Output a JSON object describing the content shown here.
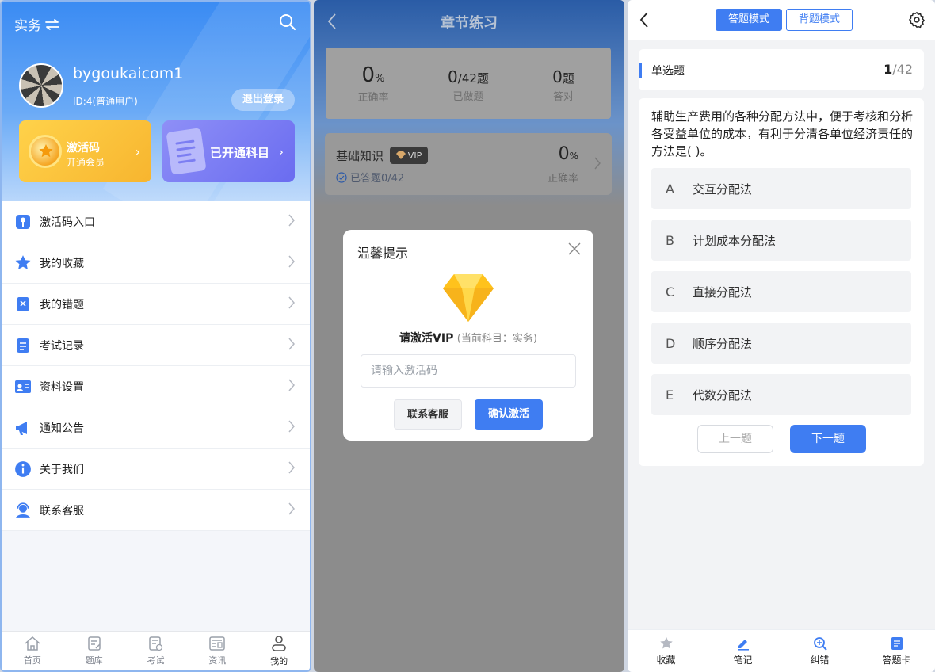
{
  "colors": {
    "primary": "#3f7df2",
    "header_blue": "#3a8bf3",
    "card_yellow": "#f7b52f",
    "card_purple": "#6a6cf0"
  },
  "mine": {
    "subject": "实务",
    "switch_icon": "swap-arrows-icon",
    "user": {
      "name": "bygoukaicom1",
      "id": "ID:4(普通用户)"
    },
    "logout_label": "退出登录",
    "activation_card": {
      "title": "激活码",
      "subtitle": "开通会员"
    },
    "subjects_card": {
      "title": "已开通科目"
    },
    "menu": [
      {
        "label": "激活码入口",
        "icon": "key-icon"
      },
      {
        "label": "我的收藏",
        "icon": "star-icon"
      },
      {
        "label": "我的错题",
        "icon": "error-book-icon"
      },
      {
        "label": "考试记录",
        "icon": "record-icon"
      },
      {
        "label": "资料设置",
        "icon": "id-card-icon"
      },
      {
        "label": "通知公告",
        "icon": "megaphone-icon"
      },
      {
        "label": "关于我们",
        "icon": "info-icon"
      },
      {
        "label": "联系客服",
        "icon": "service-icon"
      }
    ],
    "tabs": [
      {
        "label": "首页",
        "icon": "home-icon"
      },
      {
        "label": "题库",
        "icon": "question-bank-icon"
      },
      {
        "label": "考试",
        "icon": "exam-icon"
      },
      {
        "label": "资讯",
        "icon": "news-icon"
      },
      {
        "label": "我的",
        "icon": "user-icon",
        "active": true
      }
    ]
  },
  "chapter": {
    "title": "章节练习",
    "stats": {
      "accuracy_value": "0",
      "accuracy_unit": "%",
      "accuracy_label": "正确率",
      "done_value": "0",
      "done_total": "/42题",
      "done_label": "已做题",
      "correct_value": "0",
      "correct_unit": "题",
      "correct_label": "答对"
    },
    "item": {
      "name": "基础知识",
      "badge": "VIP",
      "answered": "已答题0/42",
      "rate_value": "0",
      "rate_unit": "%",
      "rate_label": "正确率"
    },
    "modal": {
      "title": "温馨提示",
      "message_bold": "请激活VIP",
      "message_note": "(当前科目：实务)",
      "input_placeholder": "请输入激活码",
      "contact_label": "联系客服",
      "confirm_label": "确认激活"
    }
  },
  "quiz": {
    "mode_answer": "答题模式",
    "mode_memorize": "背题模式",
    "question_type": "单选题",
    "current": "1",
    "total": "/42",
    "question": "辅助生产费用的各种分配方法中，便于考核和分析各受益单位的成本，有利于分清各单位经济责任的方法是( )。",
    "options": [
      {
        "letter": "A",
        "text": "交互分配法"
      },
      {
        "letter": "B",
        "text": "计划成本分配法"
      },
      {
        "letter": "C",
        "text": "直接分配法"
      },
      {
        "letter": "D",
        "text": "顺序分配法"
      },
      {
        "letter": "E",
        "text": "代数分配法"
      }
    ],
    "prev_label": "上一题",
    "next_label": "下一题",
    "footer": [
      {
        "label": "收藏",
        "icon": "star-outline-icon"
      },
      {
        "label": "笔记",
        "icon": "pen-icon"
      },
      {
        "label": "纠错",
        "icon": "magnifier-check-icon"
      },
      {
        "label": "答题卡",
        "icon": "answer-card-icon"
      }
    ]
  }
}
